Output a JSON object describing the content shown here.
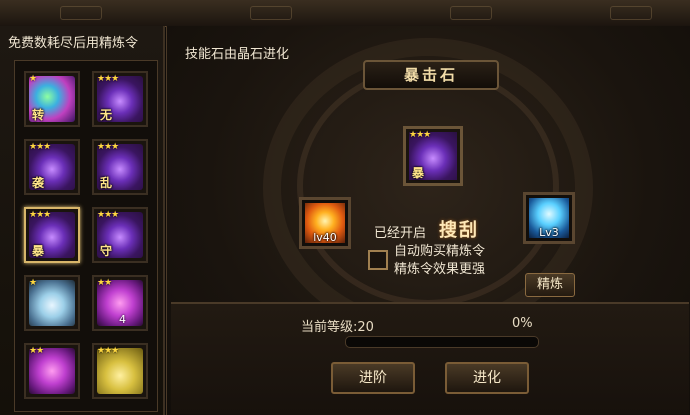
{
  "left_panel": {
    "title": "免费数耗尽后用精炼令",
    "items": [
      {
        "stars": "★",
        "glyph": "转",
        "art": "rainbow"
      },
      {
        "stars": "★★★",
        "glyph": "无",
        "art": "purple"
      },
      {
        "stars": "★★★",
        "glyph": "袭",
        "art": "purple"
      },
      {
        "stars": "★★★",
        "glyph": "乱",
        "art": "purple"
      },
      {
        "stars": "★★★",
        "glyph": "暴",
        "art": "purple",
        "selected": true
      },
      {
        "stars": "★★★",
        "glyph": "守",
        "art": "purple"
      },
      {
        "stars": "★",
        "glyph": "",
        "art": "diamond"
      },
      {
        "stars": "★★",
        "glyph": "",
        "art": "crystal",
        "count": "4"
      },
      {
        "stars": "★★",
        "glyph": "",
        "art": "crystal"
      },
      {
        "stars": "★★★",
        "glyph": "",
        "art": "yellow"
      }
    ]
  },
  "main": {
    "title": "技能石由晶石进化",
    "stone_name": "暴击石",
    "center_stone": {
      "stars": "★★★",
      "glyph": "暴"
    },
    "left_skill": {
      "level": "lv40"
    },
    "right_skill": {
      "level": "Lv3"
    },
    "opened_text": "已经开启",
    "skill_name": "搜刮",
    "auto_buy_line1": "自动购买精炼令",
    "auto_buy_line2": "精炼令效果更强",
    "refine_button": "精炼"
  },
  "progress": {
    "level_label": "当前等级:20",
    "percent_label": "0%",
    "percent": 0
  },
  "buttons": {
    "advance": "进阶",
    "evolve": "进化"
  }
}
